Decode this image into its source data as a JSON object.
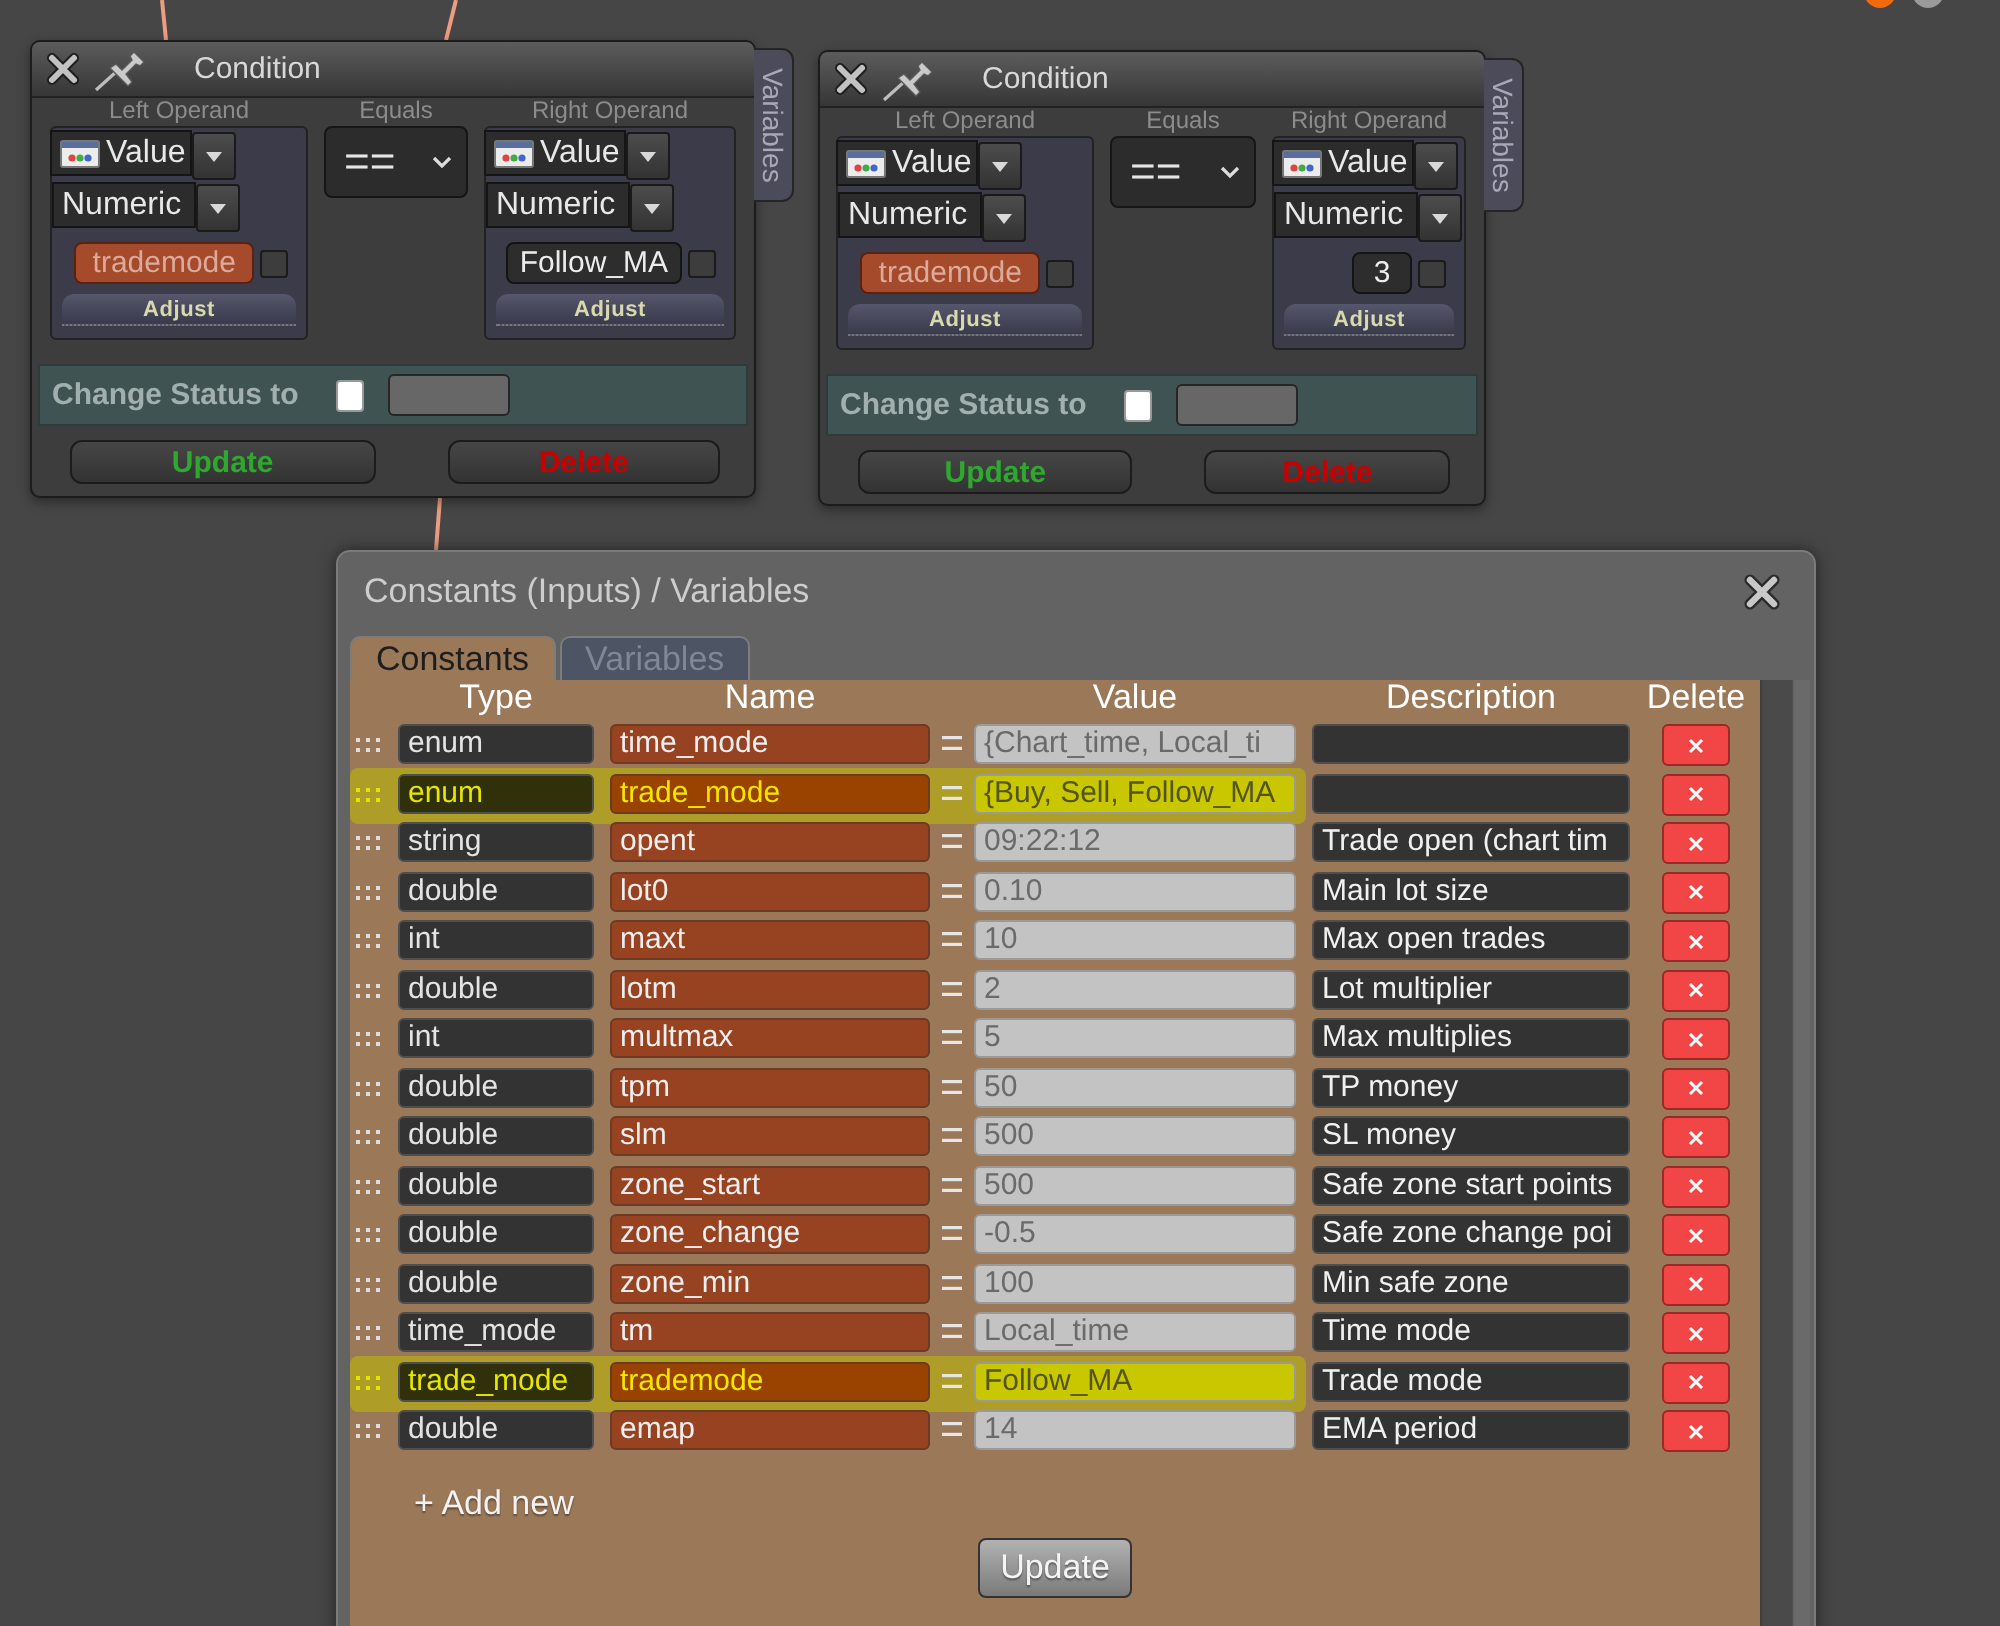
{
  "conditions": [
    {
      "title": "Condition",
      "side_tab": "Variables",
      "left": {
        "label": "Left Operand",
        "source": "Value",
        "data_type": "Numeric",
        "operand": {
          "kind": "variable",
          "text": "trademode"
        },
        "checked": false,
        "adjust": "Adjust"
      },
      "operator": {
        "label": "Equals",
        "value": "=="
      },
      "right": {
        "label": "Right Operand",
        "source": "Value",
        "data_type": "Numeric",
        "operand": {
          "kind": "constant",
          "text": "Follow_MA"
        },
        "checked": false,
        "adjust": "Adjust"
      },
      "status": {
        "label": "Change Status to",
        "checked": false
      },
      "buttons": [
        {
          "kind": "update",
          "label": "Update"
        },
        {
          "kind": "delete",
          "label": "Delete"
        }
      ]
    },
    {
      "title": "Condition",
      "side_tab": "Variables",
      "left": {
        "label": "Left Operand",
        "source": "Value",
        "data_type": "Numeric",
        "operand": {
          "kind": "variable",
          "text": "trademode"
        },
        "checked": false,
        "adjust": "Adjust"
      },
      "operator": {
        "label": "Equals",
        "value": "=="
      },
      "right": {
        "label": "Right Operand",
        "source": "Value",
        "data_type": "Numeric",
        "operand": {
          "kind": "constant",
          "text": "3"
        },
        "checked": false,
        "adjust": "Adjust"
      },
      "status": {
        "label": "Change Status to",
        "checked": false
      },
      "buttons": [
        {
          "kind": "update",
          "label": "Update"
        },
        {
          "kind": "delete",
          "label": "Delete"
        }
      ]
    }
  ],
  "dialog": {
    "title": "Constants (Inputs) / Variables",
    "tabs": [
      {
        "label": "Constants",
        "selected": true
      },
      {
        "label": "Variables",
        "selected": false
      }
    ],
    "columns": [
      "Type",
      "Name",
      "Value",
      "Description",
      "Delete"
    ],
    "rows": [
      {
        "type": "enum",
        "name": "time_mode",
        "value": "{Chart_time, Local_ti",
        "highlighted": false
      },
      {
        "type": "enum",
        "name": "trade_mode",
        "value": "{Buy, Sell, Follow_MA",
        "highlighted": true
      },
      {
        "type": "string",
        "name": "opent",
        "value": "09:22:12",
        "description": "Trade open (chart tim",
        "highlighted": false
      },
      {
        "type": "double",
        "name": "lot0",
        "value": "0.10",
        "description": "Main lot size",
        "highlighted": false
      },
      {
        "type": "int",
        "name": "maxt",
        "value": "10",
        "description": "Max open trades",
        "highlighted": false
      },
      {
        "type": "double",
        "name": "lotm",
        "value": "2",
        "description": "Lot multiplier",
        "highlighted": false
      },
      {
        "type": "int",
        "name": "multmax",
        "value": "5",
        "description": "Max multiplies",
        "highlighted": false
      },
      {
        "type": "double",
        "name": "tpm",
        "value": "50",
        "description": "TP money",
        "highlighted": false
      },
      {
        "type": "double",
        "name": "slm",
        "value": "500",
        "description": "SL money",
        "highlighted": false
      },
      {
        "type": "double",
        "name": "zone_start",
        "value": "500",
        "description": "Safe zone start points",
        "highlighted": false
      },
      {
        "type": "double",
        "name": "zone_change",
        "value": "-0.5",
        "description": "Safe zone change poi",
        "highlighted": false
      },
      {
        "type": "double",
        "name": "zone_min",
        "value": "100",
        "description": "Min safe zone",
        "highlighted": false
      },
      {
        "type": "time_mode",
        "name": "tm",
        "value": "Local_time",
        "description": "Time mode",
        "highlighted": false
      },
      {
        "type": "trade_mode",
        "name": "trademode",
        "value": "Follow_MA",
        "description": "Trade mode",
        "highlighted": true
      },
      {
        "type": "double",
        "name": "emap",
        "value": "14",
        "description": "EMA period",
        "highlighted": false
      }
    ],
    "add_new": "+ Add new",
    "update": "Update"
  }
}
